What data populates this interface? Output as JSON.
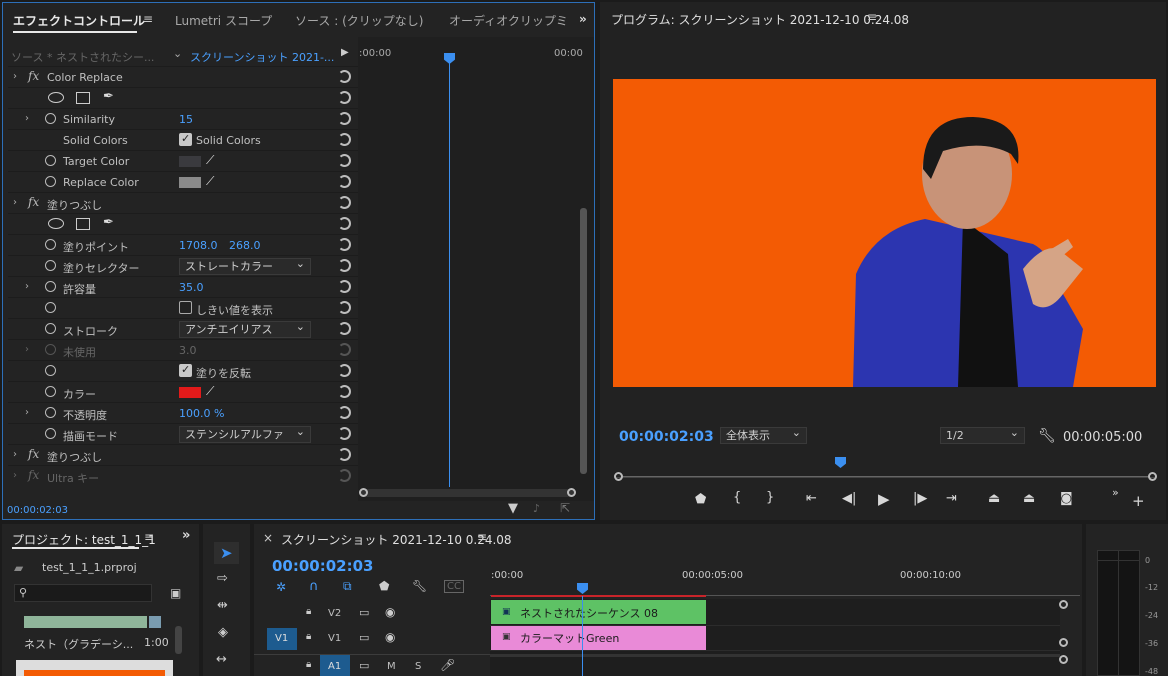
{
  "ec": {
    "tab_effect": "エフェクトコントロール",
    "tab_lumetri": "Lumetri スコープ",
    "tab_source": "ソース : (クリップなし)",
    "tab_audio": "オーディオクリップミ",
    "source": "ソース * ネストされたシー...",
    "seq": "スクリーンショット 2021-...",
    "t_start": ":00:00",
    "t_end": "00:00",
    "time": "00:00:02:03",
    "rows": [
      {
        "chev": "›",
        "fx": "fx",
        "label": "Color Replace"
      },
      {
        "masks": true
      },
      {
        "chev": "›",
        "stop": true,
        "label": "Similarity",
        "value": "15"
      },
      {
        "checkbox": true,
        "checked": true,
        "label": "Solid Colors"
      },
      {
        "stop": true,
        "label": "Target Color",
        "swatch": "#3a3a3e"
      },
      {
        "stop": true,
        "label": "Replace Color",
        "swatch": "#8a8a8a"
      },
      {
        "chev": "›",
        "fx": "fx",
        "label": "塗りつぶし"
      },
      {
        "masks": true
      },
      {
        "stop": true,
        "label": "塗りポイント",
        "value": "1708.0",
        "value2": "268.0"
      },
      {
        "stop": true,
        "label": "塗りセレクター",
        "dropdown": "ストレートカラー"
      },
      {
        "chev": "›",
        "stop": true,
        "label": "許容量",
        "value": "35.0"
      },
      {
        "stop": true,
        "checkbox": true,
        "checked": false,
        "label2": "しきい値を表示"
      },
      {
        "stop": true,
        "label": "ストローク",
        "dropdown": "アンチエイリアス"
      },
      {
        "chev": "›",
        "stop": true,
        "dim": true,
        "label": "未使用",
        "value": "3.0"
      },
      {
        "stop": true,
        "checkbox": true,
        "checked": true,
        "label2": "塗りを反転"
      },
      {
        "stop": true,
        "label": "カラー",
        "swatch": "#e21a1a"
      },
      {
        "chev": "›",
        "stop": true,
        "label": "不透明度",
        "value": "100.0 %"
      },
      {
        "stop": true,
        "label": "描画モード",
        "dropdown": "ステンシルアルファ"
      },
      {
        "chev": "›",
        "fx": "fx",
        "label": "塗りつぶし"
      },
      {
        "chev": "›",
        "fx": "fx",
        "dim": true,
        "label": "Ultra キー"
      }
    ]
  },
  "program": {
    "title": "プログラム: スクリーンショット 2021-12-10 0.24.08",
    "time": "00:00:02:03",
    "zoom": "全体表示",
    "res": "1/2",
    "duration": "00:00:05:00",
    "bg": "#f35b04"
  },
  "project": {
    "title": "プロジェクト: test_1_1_1",
    "file": "test_1_1_1.prproj",
    "item": "ネスト（グラデーシ...",
    "dur": "1:00"
  },
  "timeline": {
    "title": "スクリーンショット 2021-12-10 0.24.08",
    "time": "00:00:02:03",
    "r0": ":00:00",
    "r1": "00:00:05:00",
    "r2": "00:00:10:00",
    "tracks": {
      "v2": "V2",
      "v1": "V1",
      "v1src": "V1",
      "a1": "A1",
      "m": "M",
      "s": "S"
    },
    "clip1": "ネストされたシーケンス 08",
    "clip2": "カラーマットGreen"
  },
  "meter": {
    "labels": [
      "0",
      "-12",
      "-24",
      "-36",
      "-48"
    ]
  }
}
